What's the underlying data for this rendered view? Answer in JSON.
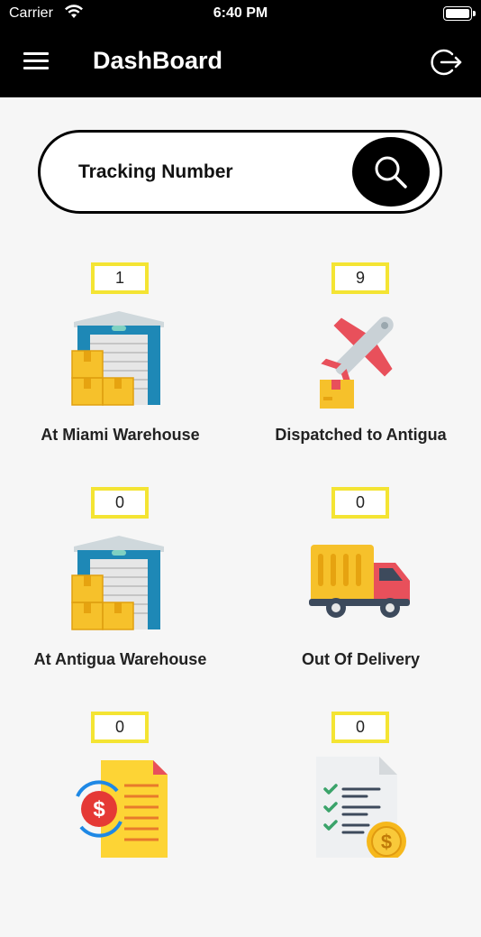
{
  "status": {
    "carrier": "Carrier",
    "time": "6:40 PM"
  },
  "header": {
    "title": "DashBoard"
  },
  "search": {
    "placeholder": "Tracking Number"
  },
  "tiles": [
    {
      "count": "1",
      "label": "At Miami Warehouse",
      "icon": "warehouse-icon"
    },
    {
      "count": "9",
      "label": "Dispatched to Antigua",
      "icon": "airplane-icon"
    },
    {
      "count": "0",
      "label": "At Antigua Warehouse",
      "icon": "warehouse-icon"
    },
    {
      "count": "0",
      "label": "Out Of Delivery",
      "icon": "delivery-truck-icon"
    },
    {
      "count": "0",
      "label": "",
      "icon": "payment-document-icon"
    },
    {
      "count": "0",
      "label": "",
      "icon": "invoice-checklist-icon"
    }
  ]
}
